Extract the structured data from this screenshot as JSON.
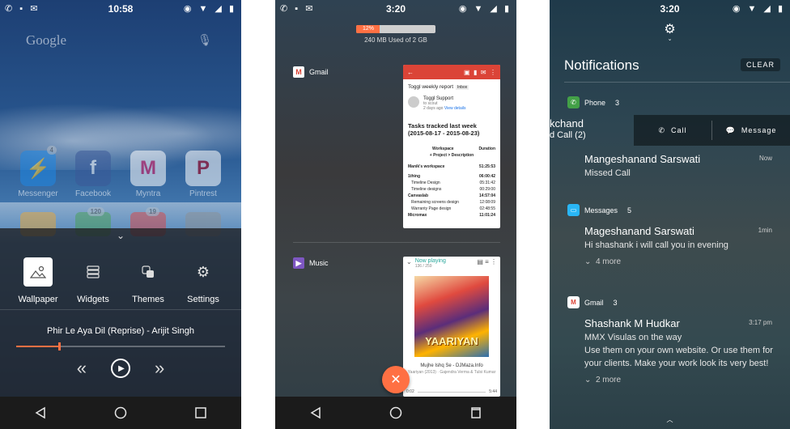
{
  "screens": {
    "launcher": {
      "status": {
        "time": "10:58"
      },
      "search": {
        "brand": "Google"
      },
      "apps": [
        {
          "label": "Messenger",
          "badge": "4",
          "color": "#1e88e5"
        },
        {
          "label": "Facebook",
          "badge": "",
          "color": "#3b5998"
        },
        {
          "label": "Myntra",
          "badge": "",
          "color": "#ffffff"
        },
        {
          "label": "Pintrest",
          "badge": "",
          "color": "#ffffff"
        }
      ],
      "apps_row2_badges": [
        "",
        "120",
        "19",
        ""
      ],
      "menu": [
        {
          "label": "Wallpaper",
          "icon": "wallpaper-icon",
          "active": true
        },
        {
          "label": "Widgets",
          "icon": "widgets-icon",
          "active": false
        },
        {
          "label": "Themes",
          "icon": "themes-icon",
          "active": false
        },
        {
          "label": "Settings",
          "icon": "gear-icon",
          "active": false
        }
      ],
      "player": {
        "song": "Phir Le Aya Dil (Reprise) - Arijit Singh",
        "progress": 0.2
      }
    },
    "recents": {
      "status": {
        "time": "3:20"
      },
      "memory": {
        "percent": "12%",
        "fraction": 0.12,
        "text": "240 MB Used of 2 GB"
      },
      "gmail": {
        "app": "Gmail",
        "subject": "Toggl weekly report",
        "tag": "Inbox",
        "sender": "Toggl Support",
        "to": "to scout",
        "date": "2 days ago",
        "details": "View details",
        "heading": "Tasks tracked last week (2015-08-17 - 2015-08-23)",
        "col_workspace": "Workspace",
        "col_duration": "Duration",
        "sub_header": "+ Project > Description",
        "workspace_name": "Manik's workspace",
        "workspace_total": "51:25:53",
        "rows": [
          {
            "name": "1thing",
            "value": "06:00:42",
            "bold": true
          },
          {
            "name": "Timeline Design",
            "value": "05:31:42",
            "bold": false
          },
          {
            "name": "Timeline designs",
            "value": "00:29:00",
            "bold": false
          },
          {
            "name": "Canvaslab",
            "value": "14:57:04",
            "bold": true
          },
          {
            "name": "Remaining screens design",
            "value": "12:08:09",
            "bold": false
          },
          {
            "name": "Warranty Page design",
            "value": "02:48:55",
            "bold": false
          },
          {
            "name": "Micromax",
            "value": "11:01:24",
            "bold": true
          }
        ]
      },
      "music": {
        "app": "Music",
        "now_playing": "Now playing",
        "count": "136 / 259",
        "album_text": "YAARIYAN",
        "title": "Mujhe Ishq Se - DJMaza.Info",
        "subtitle": "Yaariyan (2013) · Gajendra Verma & Tulsi Kumar",
        "elapsed": "0:02",
        "total": "5:44"
      }
    },
    "notifications": {
      "status": {
        "time": "3:20"
      },
      "title": "Notifications",
      "clear": "CLEAR",
      "groups": {
        "phone": {
          "label": "Phone",
          "count": "3"
        },
        "messages": {
          "label": "Messages",
          "count": "5"
        },
        "gmail": {
          "label": "Gmail",
          "count": "3"
        }
      },
      "swiped": {
        "name": "kchand",
        "sub": "d Call (2)",
        "call": "Call",
        "message": "Message"
      },
      "items": {
        "missed": {
          "name": "Mangeshanand Sarswati",
          "time": "Now",
          "text": "Missed Call"
        },
        "sms": {
          "name": "Mageshanand Sarswati",
          "time": "1min",
          "text": "Hi shashank i will call you in evening",
          "more": "4 more"
        },
        "mail": {
          "name": "Shashank M Hudkar",
          "time": "3:17 pm",
          "text": "MMX Visulas on the way\nUse them on your own website. Or use them for your clients. Make your work look its very best!",
          "more": "2 more"
        }
      }
    }
  }
}
